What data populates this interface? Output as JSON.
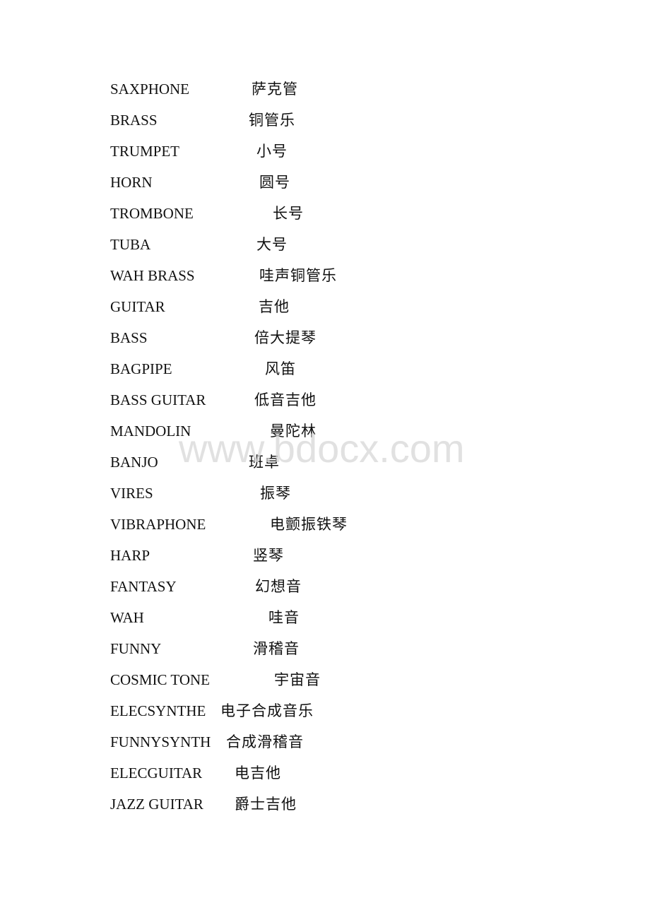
{
  "document": {
    "entries": [
      {
        "english": "SAXPHONE",
        "chinese": "萨克管"
      },
      {
        "english": "BRASS",
        "chinese": "铜管乐"
      },
      {
        "english": "TRUMPET",
        "chinese": "小号"
      },
      {
        "english": "HORN",
        "chinese": "圆号"
      },
      {
        "english": "TROMBONE",
        "chinese": "长号"
      },
      {
        "english": "TUBA",
        "chinese": "大号"
      },
      {
        "english": "WAH BRASS",
        "chinese": "哇声铜管乐"
      },
      {
        "english": "GUITAR",
        "chinese": "吉他"
      },
      {
        "english": "BASS",
        "chinese": "倍大提琴"
      },
      {
        "english": "BAGPIPE",
        "chinese": "风笛"
      },
      {
        "english": "BASS GUITAR",
        "chinese": "低音吉他"
      },
      {
        "english": "MANDOLIN",
        "chinese": "曼陀林"
      },
      {
        "english": "BANJO",
        "chinese": "班卓"
      },
      {
        "english": "VIRES",
        "chinese": "振琴"
      },
      {
        "english": "VIBRAPHONE",
        "chinese": "电颤振铁琴"
      },
      {
        "english": "HARP",
        "chinese": "竖琴"
      },
      {
        "english": "FANTASY",
        "chinese": "幻想音"
      },
      {
        "english": "WAH",
        "chinese": "哇音"
      },
      {
        "english": "FUNNY",
        "chinese": "滑稽音"
      },
      {
        "english": "COSMIC TONE",
        "chinese": "宇宙音"
      },
      {
        "english": "ELECSYNTHE",
        "chinese": "电子合成音乐"
      },
      {
        "english": "FUNNYSYNTH",
        "chinese": "合成滑稽音"
      },
      {
        "english": "ELECGUITAR",
        "chinese": "电吉他"
      },
      {
        "english": "JAZZ GUITAR",
        "chinese": "爵士吉他"
      }
    ]
  },
  "watermark": {
    "text": "www.bdocx.com"
  }
}
